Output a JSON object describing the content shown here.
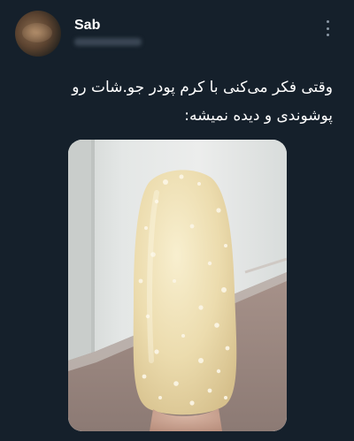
{
  "tweet": {
    "author": {
      "display_name": "Sab"
    },
    "text": "وقتی فکر می‌کنی با کرم پودر جو.شات رو پوشوندی و دیده نمیشه:",
    "media": {
      "icon": "ice-cream-photo"
    },
    "menu_icon": "more-vertical-icon"
  },
  "colors": {
    "background": "#15202b",
    "text": "#ffffff",
    "secondary": "#8b98a5"
  }
}
